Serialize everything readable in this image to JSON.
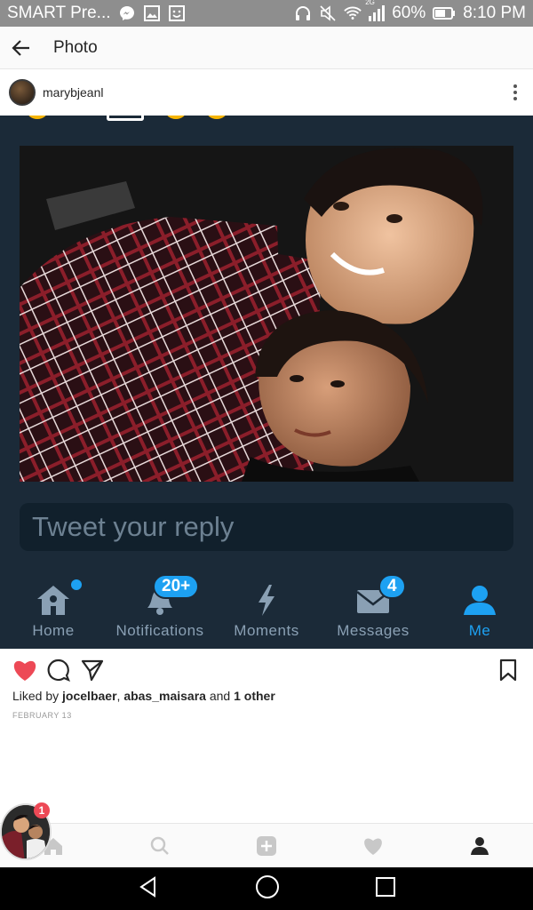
{
  "status_bar": {
    "carrier": "SMART Pre...",
    "network": "2G",
    "battery": "60%",
    "time": "8:10 PM"
  },
  "app_bar": {
    "title": "Photo"
  },
  "post": {
    "username": "marybjeanl",
    "reply_placeholder": "Tweet your reply",
    "tabs": [
      {
        "label": "Home",
        "icon": "home-icon",
        "badge": ""
      },
      {
        "label": "Notifications",
        "icon": "bell-icon",
        "badge": "20+"
      },
      {
        "label": "Moments",
        "icon": "lightning-icon",
        "badge": ""
      },
      {
        "label": "Messages",
        "icon": "envelope-icon",
        "badge": "4"
      },
      {
        "label": "Me",
        "icon": "person-icon",
        "badge": ""
      }
    ]
  },
  "likes": {
    "prefix": "Liked by ",
    "user1": "jocelbaer",
    "sep": ", ",
    "user2": "abas_maisara",
    "and": " and ",
    "other": "1 other"
  },
  "date": "FEBRUARY 13",
  "floating_badge": "1",
  "colors": {
    "twitter_blue": "#1da1f2",
    "like_red": "#ed4956",
    "post_bg": "#1b2a38"
  }
}
